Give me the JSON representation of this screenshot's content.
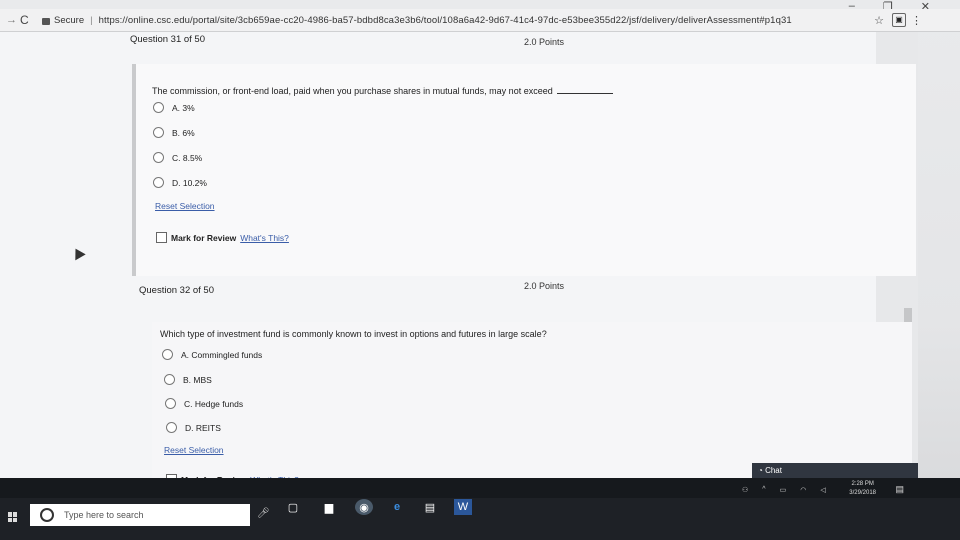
{
  "browser": {
    "secure_label": "Secure",
    "url": "https://online.csc.edu/portal/site/3cb659ae-cc20-4986-ba57-bdbd8ca3e3b6/tool/108a6a42-9d67-41c4-97dc-e53bee355d22/jsf/delivery/deliverAssessment#p1q31",
    "star_glyph": "☆",
    "menu_glyph": "⋮",
    "ext_glyph": "▣",
    "back_glyph": "→",
    "reload_glyph": "C"
  },
  "questions": [
    {
      "header": "Question 31 of 50",
      "points": "2.0 Points",
      "text": "The commission, or front-end load, paid when you purchase shares in mutual funds, may not exceed",
      "options": [
        "A. 3%",
        "B. 6%",
        "C. 8.5%",
        "D. 10.2%"
      ],
      "reset_label": "Reset Selection",
      "mark_label": "Mark for Review",
      "whats_this": "What's This?"
    },
    {
      "header": "Question 32 of 50",
      "points": "2.0 Points",
      "text": "Which type of investment fund is commonly known to invest in options and futures in large scale?",
      "options": [
        "A. Commingled funds",
        "B. MBS",
        "C. Hedge funds",
        "D. REITS"
      ],
      "reset_label": "Reset Selection",
      "mark_label": "Mark for Review",
      "whats_this": "What's This?"
    }
  ],
  "chat": {
    "label": "Chat"
  },
  "taskbar": {
    "search_placeholder": "Type here to search",
    "clock_time": "2:28 PM",
    "clock_date": "3/29/2018"
  }
}
